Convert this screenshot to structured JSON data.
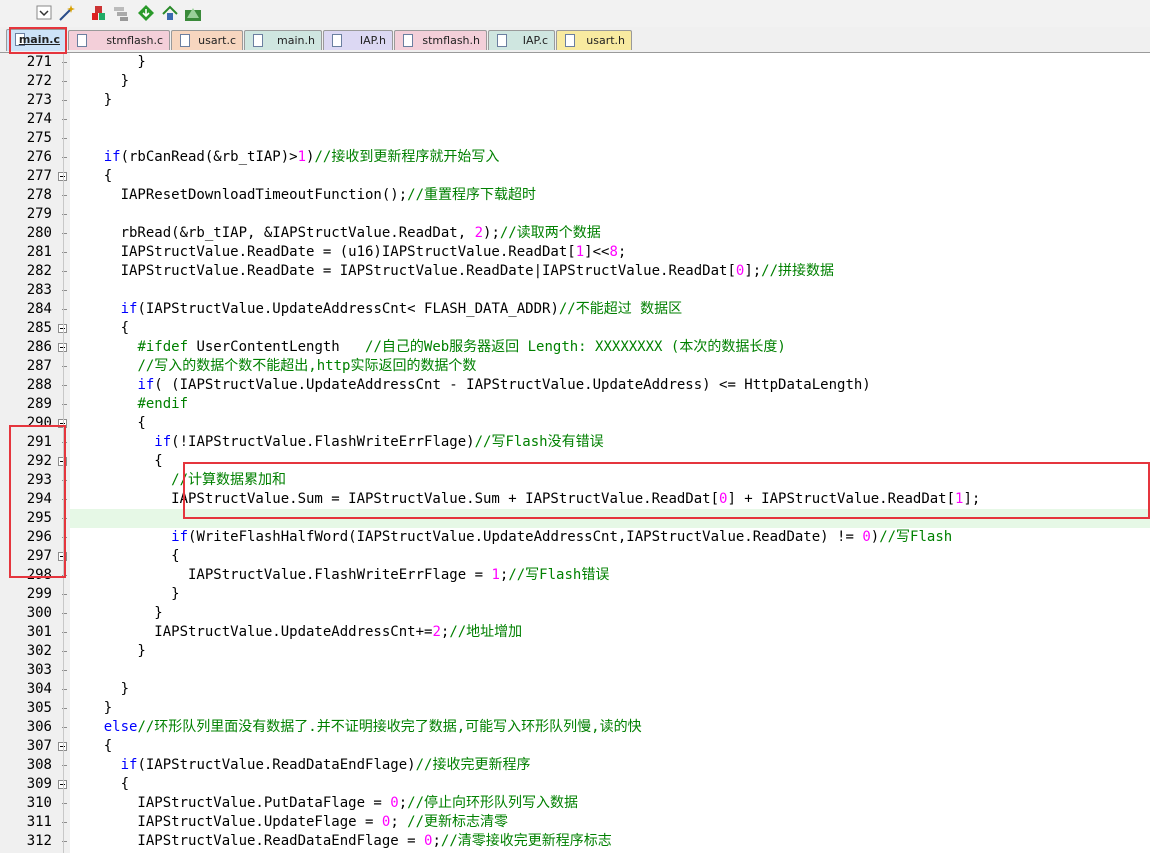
{
  "tabs": [
    {
      "label": "main.c",
      "color": "#cde3f8",
      "active": true
    },
    {
      "label": "stmflash.c",
      "color": "#f3cfd9",
      "active": false
    },
    {
      "label": "usart.c",
      "color": "#f7d6bf",
      "active": false
    },
    {
      "label": "main.h",
      "color": "#cfe6e0",
      "active": false
    },
    {
      "label": "IAP.h",
      "color": "#dcd8f3",
      "active": false
    },
    {
      "label": "stmflash.h",
      "color": "#f3cfd9",
      "active": false
    },
    {
      "label": "IAP.c",
      "color": "#cfe6e0",
      "active": false
    },
    {
      "label": "usart.h",
      "color": "#f8eaa0",
      "active": false
    }
  ],
  "toolbar_icons": [
    "dropdown-icon",
    "wand-icon",
    "build-icon",
    "batch-build-icon",
    "download-icon",
    "insert-icon",
    "debug-icon"
  ],
  "editor": {
    "current_line": 295,
    "lines": [
      {
        "n": 271,
        "fold": false,
        "tokens": [
          [
            "t",
            "        }"
          ]
        ]
      },
      {
        "n": 272,
        "fold": false,
        "tokens": [
          [
            "t",
            "      }"
          ]
        ]
      },
      {
        "n": 273,
        "fold": false,
        "tokens": [
          [
            "t",
            "    }"
          ]
        ]
      },
      {
        "n": 274,
        "fold": false,
        "tokens": []
      },
      {
        "n": 275,
        "fold": false,
        "tokens": []
      },
      {
        "n": 276,
        "fold": false,
        "tokens": [
          [
            "t",
            "    "
          ],
          [
            "k",
            "if"
          ],
          [
            "t",
            "(rbCanRead(&rb_tIAP)>"
          ],
          [
            "n",
            "1"
          ],
          [
            "t",
            ")"
          ],
          [
            "c",
            "//接收到更新程序就开始写入"
          ]
        ]
      },
      {
        "n": 277,
        "fold": true,
        "tokens": [
          [
            "t",
            "    {"
          ]
        ]
      },
      {
        "n": 278,
        "fold": false,
        "tokens": [
          [
            "t",
            "      IAPResetDownloadTimeoutFunction();"
          ],
          [
            "c",
            "//重置程序下载超时"
          ]
        ]
      },
      {
        "n": 279,
        "fold": false,
        "tokens": []
      },
      {
        "n": 280,
        "fold": false,
        "tokens": [
          [
            "t",
            "      rbRead(&rb_tIAP, &IAPStructValue.ReadDat, "
          ],
          [
            "n",
            "2"
          ],
          [
            "t",
            ");"
          ],
          [
            "c",
            "//读取两个数据"
          ]
        ]
      },
      {
        "n": 281,
        "fold": false,
        "tokens": [
          [
            "t",
            "      IAPStructValue.ReadDate = (u16)IAPStructValue.ReadDat["
          ],
          [
            "n",
            "1"
          ],
          [
            "t",
            "]<<"
          ],
          [
            "n",
            "8"
          ],
          [
            "t",
            ";"
          ]
        ]
      },
      {
        "n": 282,
        "fold": false,
        "tokens": [
          [
            "t",
            "      IAPStructValue.ReadDate = IAPStructValue.ReadDate|IAPStructValue.ReadDat["
          ],
          [
            "n",
            "0"
          ],
          [
            "t",
            "];"
          ],
          [
            "c",
            "//拼接数据"
          ]
        ]
      },
      {
        "n": 283,
        "fold": false,
        "tokens": []
      },
      {
        "n": 284,
        "fold": false,
        "tokens": [
          [
            "t",
            "      "
          ],
          [
            "k",
            "if"
          ],
          [
            "t",
            "(IAPStructValue.UpdateAddressCnt< FLASH_DATA_ADDR)"
          ],
          [
            "c",
            "//不能超过 数据区"
          ]
        ]
      },
      {
        "n": 285,
        "fold": true,
        "tokens": [
          [
            "t",
            "      {"
          ]
        ]
      },
      {
        "n": 286,
        "fold": true,
        "tokens": [
          [
            "t",
            "        "
          ],
          [
            "p",
            "#ifdef"
          ],
          [
            "t",
            " UserContentLength   "
          ],
          [
            "c",
            "//自己的Web服务器返回 Length: XXXXXXXX (本次的数据长度)"
          ]
        ]
      },
      {
        "n": 287,
        "fold": false,
        "tokens": [
          [
            "t",
            "        "
          ],
          [
            "c",
            "//写入的数据个数不能超出,http实际返回的数据个数"
          ]
        ]
      },
      {
        "n": 288,
        "fold": false,
        "tokens": [
          [
            "t",
            "        "
          ],
          [
            "k",
            "if"
          ],
          [
            "t",
            "( (IAPStructValue.UpdateAddressCnt - IAPStructValue.UpdateAddress) <= HttpDataLength)"
          ]
        ]
      },
      {
        "n": 289,
        "fold": false,
        "tokens": [
          [
            "t",
            "        "
          ],
          [
            "p",
            "#endif"
          ]
        ]
      },
      {
        "n": 290,
        "fold": true,
        "tokens": [
          [
            "t",
            "        {"
          ]
        ]
      },
      {
        "n": 291,
        "fold": false,
        "tokens": [
          [
            "t",
            "          "
          ],
          [
            "k",
            "if"
          ],
          [
            "t",
            "(!IAPStructValue.FlashWriteErrFlage)"
          ],
          [
            "c",
            "//写Flash没有错误"
          ]
        ]
      },
      {
        "n": 292,
        "fold": true,
        "tokens": [
          [
            "t",
            "          {"
          ]
        ]
      },
      {
        "n": 293,
        "fold": false,
        "tokens": [
          [
            "t",
            "            "
          ],
          [
            "c",
            "//计算数据累加和"
          ]
        ]
      },
      {
        "n": 294,
        "fold": false,
        "tokens": [
          [
            "t",
            "            IAPStructValue.Sum = IAPStructValue.Sum + IAPStructValue.ReadDat["
          ],
          [
            "n",
            "0"
          ],
          [
            "t",
            "] + IAPStructValue.ReadDat["
          ],
          [
            "n",
            "1"
          ],
          [
            "t",
            "];"
          ]
        ]
      },
      {
        "n": 295,
        "fold": false,
        "tokens": []
      },
      {
        "n": 296,
        "fold": false,
        "tokens": [
          [
            "t",
            "            "
          ],
          [
            "k",
            "if"
          ],
          [
            "t",
            "(WriteFlashHalfWord(IAPStructValue.UpdateAddressCnt,IAPStructValue.ReadDate) != "
          ],
          [
            "n",
            "0"
          ],
          [
            "t",
            ")"
          ],
          [
            "c",
            "//写Flash"
          ]
        ]
      },
      {
        "n": 297,
        "fold": true,
        "tokens": [
          [
            "t",
            "            {"
          ]
        ]
      },
      {
        "n": 298,
        "fold": false,
        "tokens": [
          [
            "t",
            "              IAPStructValue.FlashWriteErrFlage = "
          ],
          [
            "n",
            "1"
          ],
          [
            "t",
            ";"
          ],
          [
            "c",
            "//写Flash错误"
          ]
        ]
      },
      {
        "n": 299,
        "fold": false,
        "tokens": [
          [
            "t",
            "            }"
          ]
        ]
      },
      {
        "n": 300,
        "fold": false,
        "tokens": [
          [
            "t",
            "          }"
          ]
        ]
      },
      {
        "n": 301,
        "fold": false,
        "tokens": [
          [
            "t",
            "          IAPStructValue.UpdateAddressCnt+="
          ],
          [
            "n",
            "2"
          ],
          [
            "t",
            ";"
          ],
          [
            "c",
            "//地址增加"
          ]
        ]
      },
      {
        "n": 302,
        "fold": false,
        "tokens": [
          [
            "t",
            "        }"
          ]
        ]
      },
      {
        "n": 303,
        "fold": false,
        "tokens": []
      },
      {
        "n": 304,
        "fold": false,
        "tokens": [
          [
            "t",
            "      }"
          ]
        ]
      },
      {
        "n": 305,
        "fold": false,
        "tokens": [
          [
            "t",
            "    }"
          ]
        ]
      },
      {
        "n": 306,
        "fold": false,
        "tokens": [
          [
            "t",
            "    "
          ],
          [
            "k",
            "else"
          ],
          [
            "c",
            "//环形队列里面没有数据了.并不证明接收完了数据,可能写入环形队列慢,读的快"
          ]
        ]
      },
      {
        "n": 307,
        "fold": true,
        "tokens": [
          [
            "t",
            "    {"
          ]
        ]
      },
      {
        "n": 308,
        "fold": false,
        "tokens": [
          [
            "t",
            "      "
          ],
          [
            "k",
            "if"
          ],
          [
            "t",
            "(IAPStructValue.ReadDataEndFlage)"
          ],
          [
            "c",
            "//接收完更新程序"
          ]
        ]
      },
      {
        "n": 309,
        "fold": true,
        "tokens": [
          [
            "t",
            "      {"
          ]
        ]
      },
      {
        "n": 310,
        "fold": false,
        "tokens": [
          [
            "t",
            "        IAPStructValue.PutDataFlage = "
          ],
          [
            "n",
            "0"
          ],
          [
            "t",
            ";"
          ],
          [
            "c",
            "//停止向环形队列写入数据"
          ]
        ]
      },
      {
        "n": 311,
        "fold": false,
        "tokens": [
          [
            "t",
            "        IAPStructValue.UpdateFlage = "
          ],
          [
            "n",
            "0"
          ],
          [
            "t",
            "; "
          ],
          [
            "c",
            "//更新标志清零"
          ]
        ]
      },
      {
        "n": 312,
        "fold": false,
        "tokens": [
          [
            "t",
            "        IAPStructValue.ReadDataEndFlage = "
          ],
          [
            "n",
            "0"
          ],
          [
            "t",
            ";"
          ],
          [
            "c",
            "//清零接收完更新程序标志"
          ]
        ]
      }
    ]
  }
}
